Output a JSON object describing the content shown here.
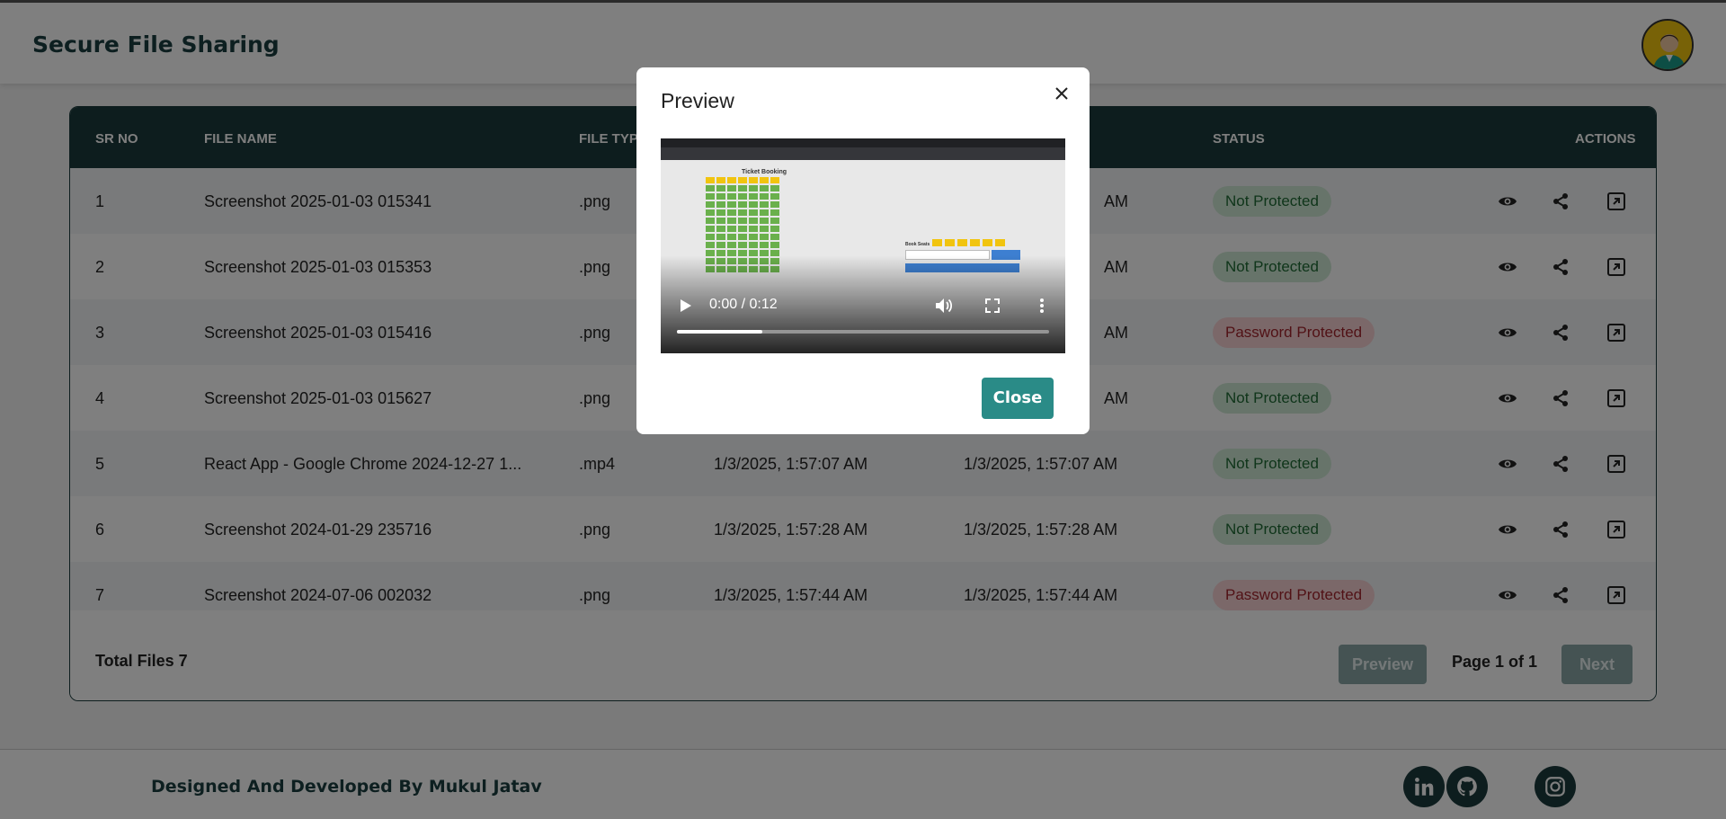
{
  "app": {
    "title": "Secure File Sharing"
  },
  "table": {
    "headers": {
      "sr": "SR NO",
      "name": "FILE NAME",
      "type": "FILE TYPE",
      "created": "",
      "updated": "",
      "status": "STATUS",
      "actions": "ACTIONS"
    },
    "rows": [
      {
        "sr": "1",
        "name": "Screenshot 2025-01-03 015341",
        "type": ".png",
        "created": "",
        "updated": "AM",
        "status": "Not Protected",
        "status_kind": "not-protected"
      },
      {
        "sr": "2",
        "name": "Screenshot 2025-01-03 015353",
        "type": ".png",
        "created": "",
        "updated": "AM",
        "status": "Not Protected",
        "status_kind": "not-protected"
      },
      {
        "sr": "3",
        "name": "Screenshot 2025-01-03 015416",
        "type": ".png",
        "created": "",
        "updated": "AM",
        "status": "Password Protected",
        "status_kind": "password-protected"
      },
      {
        "sr": "4",
        "name": "Screenshot 2025-01-03 015627",
        "type": ".png",
        "created": "",
        "updated": "AM",
        "status": "Not Protected",
        "status_kind": "not-protected"
      },
      {
        "sr": "5",
        "name": "React App - Google Chrome 2024-12-27 1...",
        "type": ".mp4",
        "created": "1/3/2025, 1:57:07 AM",
        "updated": "1/3/2025, 1:57:07 AM",
        "status": "Not Protected",
        "status_kind": "not-protected"
      },
      {
        "sr": "6",
        "name": "Screenshot 2024-01-29 235716",
        "type": ".png",
        "created": "1/3/2025, 1:57:28 AM",
        "updated": "1/3/2025, 1:57:28 AM",
        "status": "Not Protected",
        "status_kind": "not-protected"
      },
      {
        "sr": "7",
        "name": "Screenshot 2024-07-06 002032",
        "type": ".png",
        "created": "1/3/2025, 1:57:44 AM",
        "updated": "1/3/2025, 1:57:44 AM",
        "status": "Password Protected",
        "status_kind": "password-protected"
      }
    ],
    "row_actions": [
      "eye-icon",
      "share-icon",
      "open-external-icon"
    ]
  },
  "pagination": {
    "total_label": "Total Files 7",
    "prev_label": "Preview",
    "page_info": "Page 1 of 1",
    "next_label": "Next"
  },
  "footer": {
    "credit": "Designed And Developed By Mukul Jatav",
    "social": [
      "linkedin-icon",
      "github-icon",
      "instagram-icon"
    ]
  },
  "modal": {
    "title": "Preview",
    "close_button": "Close",
    "video": {
      "time": "0:00 / 0:12",
      "progress": 0.23,
      "frame_title": "Ticket Booking",
      "frame_book_label": "Book Seats"
    }
  },
  "colors": {
    "header_bg": "#1b3a3c",
    "accent": "#2a8b87",
    "not_protected_bg": "#cfe9d4",
    "password_protected_bg": "#f6d0d2"
  }
}
